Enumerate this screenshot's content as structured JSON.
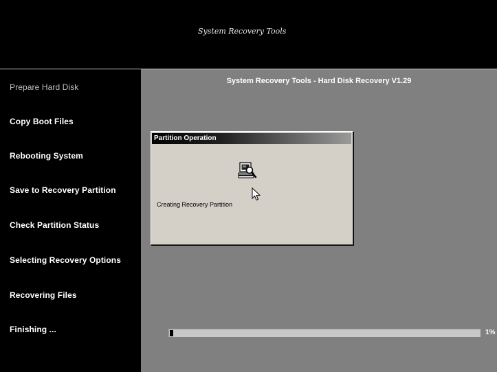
{
  "header": {
    "title": "System Recovery Tools"
  },
  "sidebar": {
    "steps": [
      {
        "label": "Prepare Hard Disk",
        "active": true
      },
      {
        "label": "Copy Boot Files",
        "active": false
      },
      {
        "label": "Rebooting System",
        "active": false
      },
      {
        "label": "Save to Recovery Partition",
        "active": false
      },
      {
        "label": "Check Partition Status",
        "active": false
      },
      {
        "label": "Selecting Recovery Options",
        "active": false
      },
      {
        "label": "Recovering Files",
        "active": false
      },
      {
        "label": "Finishing ...",
        "active": false
      }
    ]
  },
  "main": {
    "title": "System Recovery Tools - Hard Disk Recovery V1.29"
  },
  "dialog": {
    "title": "Partition Operation",
    "icon": "computer-search-icon",
    "message": "Creating Recovery Partition"
  },
  "progress": {
    "value_percent": 1,
    "label": "1%"
  },
  "colors": {
    "background": "#000000",
    "main_panel": "#808080",
    "dialog_face": "#d4d0c8",
    "progress_track": "#c8c8c8"
  }
}
